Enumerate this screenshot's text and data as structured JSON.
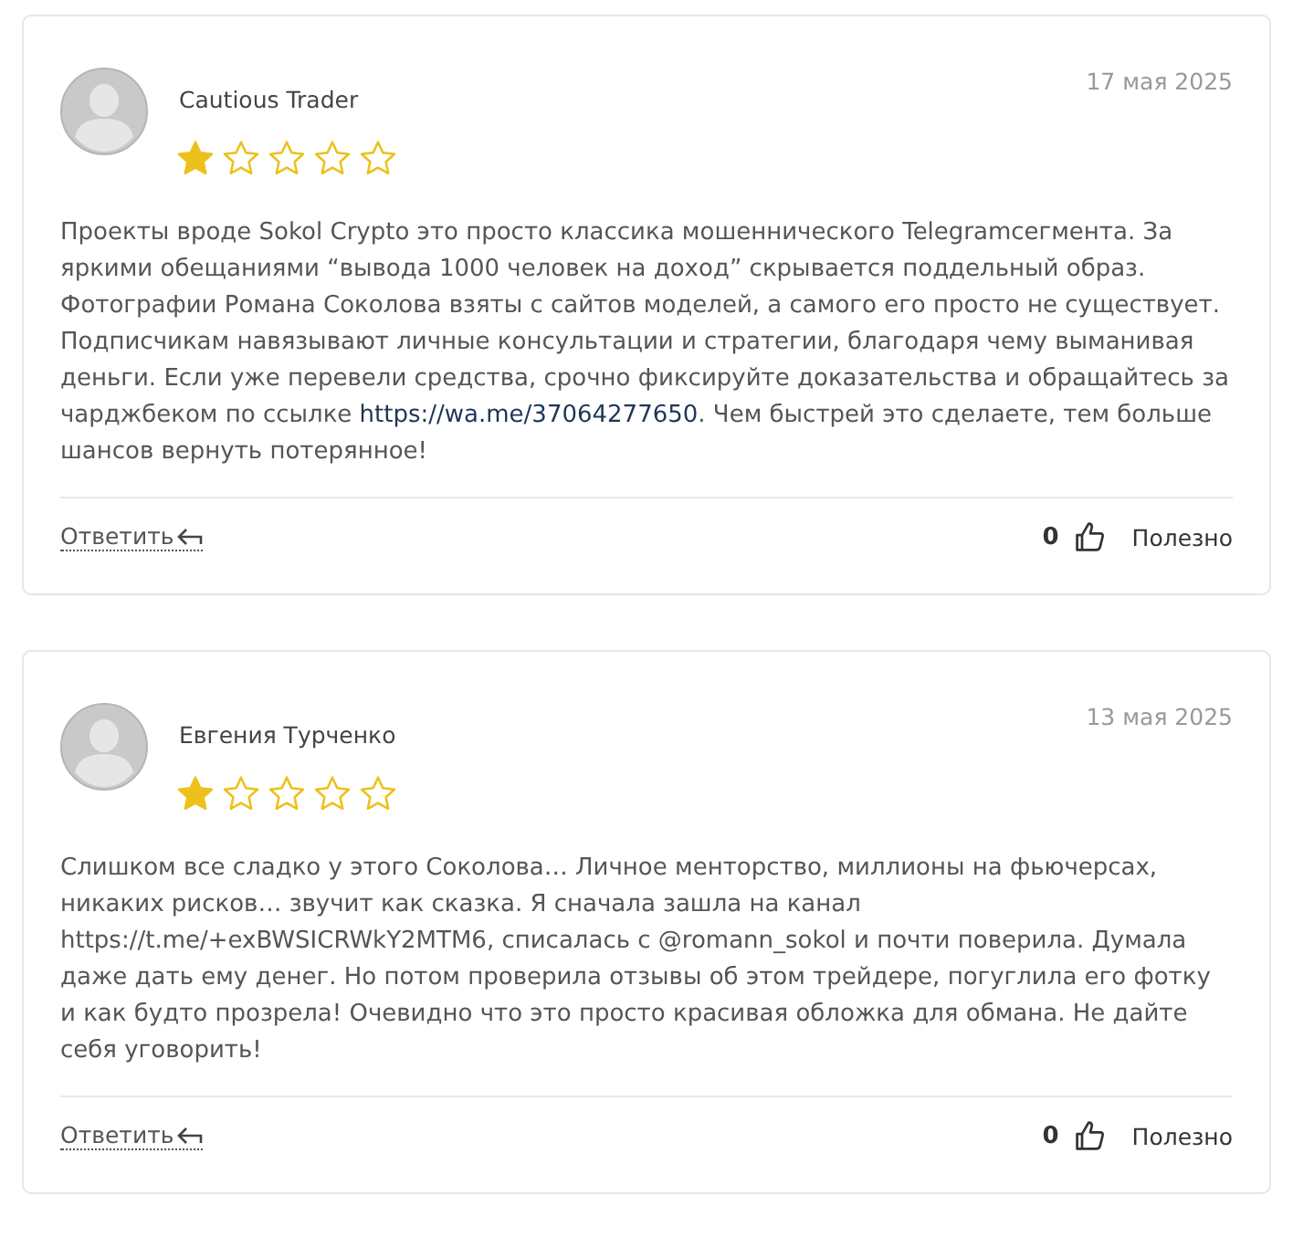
{
  "reviews": [
    {
      "author": "Cautious Trader",
      "date": "17 мая 2025",
      "stars": 1,
      "body": [
        {
          "kind": "text",
          "text": "Проекты вроде Sokol Crypto это просто классика мошеннического Telegramсегмента. За яркими обещаниями “вывода 1000 человек на доход” скрывается поддельный образ. Фотографии Романа Соколова взяты с сайтов моделей, а самого его просто не существует. Подписчикам навязывают личные консультации и стратегии, благодаря чему выманивая деньги. Если уже перевели средства, срочно фиксируйте доказательства и обращайтесь за чарджбеком по ссылке "
        },
        {
          "kind": "link",
          "text": "https://wa.me/37064277650"
        },
        {
          "kind": "text",
          "text": ". Чем быстрей это сделаете, тем больше шансов вернуть потерянное!"
        }
      ],
      "reply": "Ответить",
      "likes": "0",
      "useful": "Полезно"
    },
    {
      "author": "Евгения Турченко",
      "date": "13 мая 2025",
      "stars": 1,
      "body": [
        {
          "kind": "text",
          "text": "Слишком все сладко у этого Соколова… Личное менторство, миллионы на фьючерсах, никаких рисков… звучит как сказка. Я сначала зашла на канал https://t.me/+exBWSICRWkY2MTM6, списалась с @romann_sokol и почти поверила. Думала даже дать ему денег. Но потом проверила отзывы об этом трейдере, погуглила его фотку и как будто прозрела! Очевидно что это просто красивая обложка для обмана. Не дайте себя уговорить!"
        }
      ],
      "reply": "Ответить",
      "likes": "0",
      "useful": "Полезно"
    }
  ]
}
